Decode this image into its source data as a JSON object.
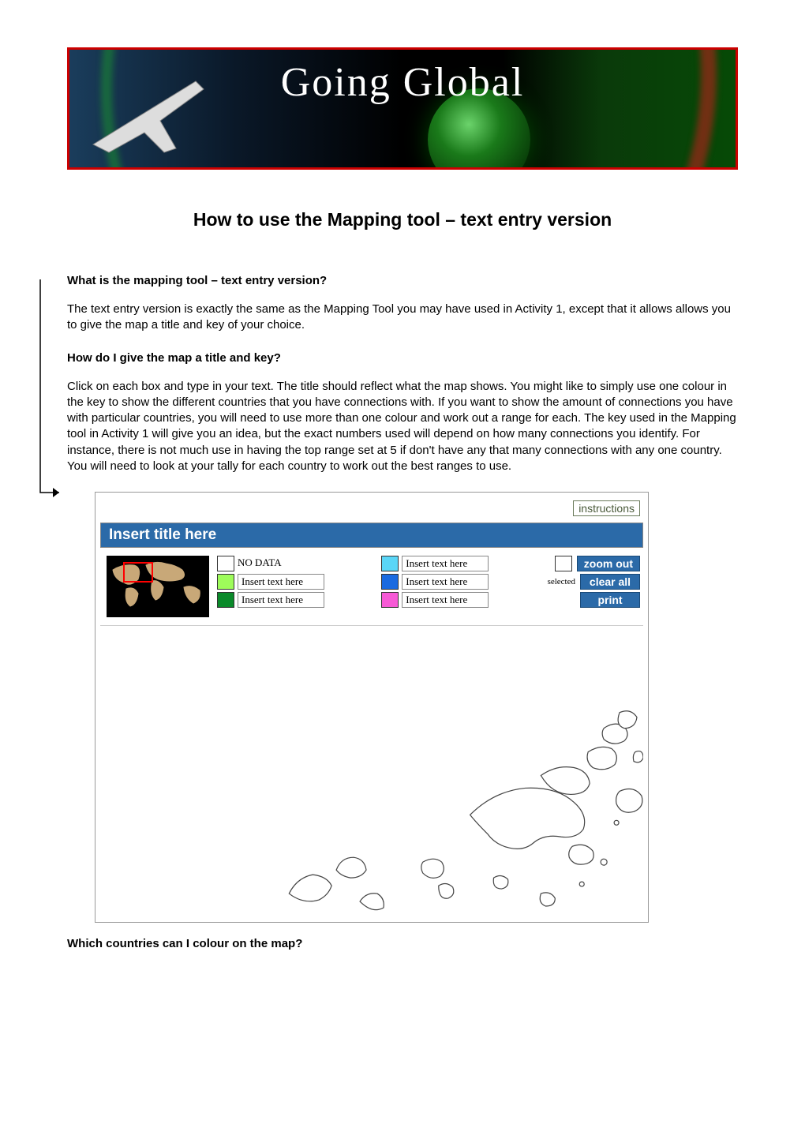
{
  "banner": {
    "title_text": "Going Global"
  },
  "page_title": "How to use the Mapping tool – text entry version",
  "section1": {
    "heading": "What is the mapping tool – text entry version?",
    "body": "The text entry version is exactly the same as the Mapping Tool you may have used in Activity 1, except that it allows allows you to give the map a title and key of your choice."
  },
  "section2": {
    "heading": "How do I give the map a title and key?",
    "body": "Click on each box and type in your text. The title should reflect what the map shows. You might like to simply use one colour in the key to show the different countries that you have connections with. If you want to show the amount of connections you have with particular countries, you will need to use more than one colour and work out a range for each. The key used in the Mapping tool in Activity 1 will give you an idea, but the exact numbers used will depend on how many connections you identify. For instance, there is not much use in having the top range set at 5 if don't have any that many connections with any one country. You will need to look at your tally for each country to work out the best ranges to use."
  },
  "tool": {
    "instructions_label": "instructions",
    "title_placeholder": "Insert title here",
    "no_data_label": "NO DATA",
    "key_placeholder": "Insert text here",
    "selected_label": "selected",
    "buttons": {
      "zoom_out": "zoom out",
      "clear_all": "clear all",
      "print": "print"
    }
  },
  "section3": {
    "heading": "Which countries can I colour on the map?"
  }
}
